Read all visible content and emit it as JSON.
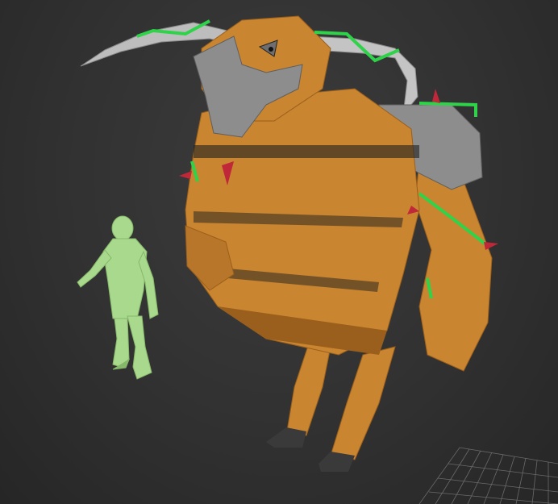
{
  "viewport": {
    "background_color": "#333333",
    "grid_color": "#7a7a7a"
  },
  "models": {
    "human_reference": {
      "color": "#a9d98c",
      "shade": "#86b86a"
    },
    "monster": {
      "body_color": "#c98530",
      "body_shade": "#9a5f1c",
      "armor_color": "#8d8d8d",
      "horn_color": "#bdbdbd",
      "thorn_color": "#2fd34a",
      "spike_color": "#c0283a",
      "hoof_color": "#3a3a3a"
    }
  }
}
